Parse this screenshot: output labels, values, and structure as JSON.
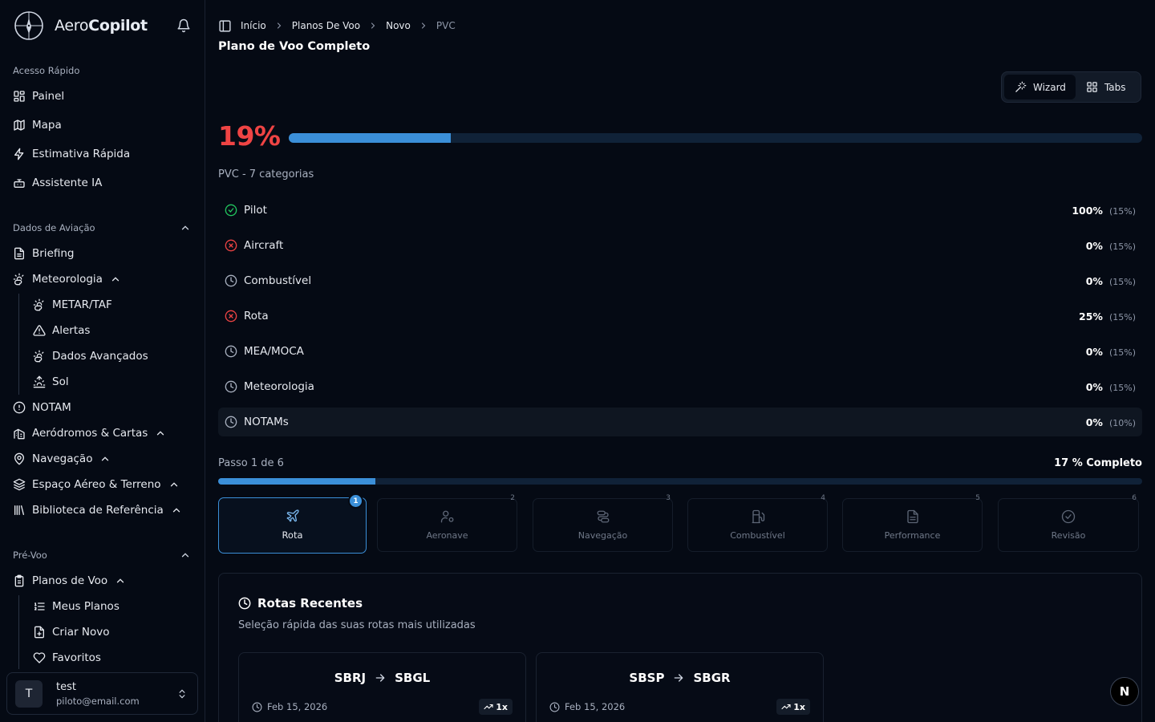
{
  "brand": {
    "name_light": "Aero",
    "name_bold": "Copilot"
  },
  "sidebar": {
    "quick_label": "Acesso Rápido",
    "quick": [
      {
        "label": "Painel",
        "icon": "dashboard-icon"
      },
      {
        "label": "Mapa",
        "icon": "map-icon"
      },
      {
        "label": "Estimativa Rápida",
        "icon": "bolt-icon"
      },
      {
        "label": "Assistente IA",
        "icon": "bot-icon"
      }
    ],
    "aviation_label": "Dados de Aviação",
    "briefing": "Briefing",
    "meteorologia": "Meteorologia",
    "meteo_sub": [
      "METAR/TAF",
      "Alertas",
      "Dados Avançados",
      "Sol"
    ],
    "notam": "NOTAM",
    "aerodromos": "Aeródromos & Cartas",
    "navegacao": "Navegação",
    "espaco": "Espaço Aéreo & Terreno",
    "biblioteca": "Biblioteca de Referência",
    "prevoo_label": "Pré-Voo",
    "planos": "Planos de Voo",
    "planos_sub": [
      "Meus Planos",
      "Criar Novo",
      "Favoritos"
    ]
  },
  "user": {
    "initial": "T",
    "name": "test",
    "email": "piloto@email.com"
  },
  "breadcrumb": [
    "Início",
    "Planos De Voo",
    "Novo",
    "PVC"
  ],
  "page_title": "Plano de Voo Completo",
  "view_toggle": {
    "wizard": "Wizard",
    "tabs": "Tabs",
    "active": "wizard"
  },
  "progress": {
    "percent_label": "19%",
    "fraction": 0.19,
    "subtitle": "PVC - 7 categorias"
  },
  "categories": [
    {
      "name": "Pilot",
      "status": "complete",
      "percent": "100%",
      "weight": "(15%)"
    },
    {
      "name": "Aircraft",
      "status": "error",
      "percent": "0%",
      "weight": "(15%)"
    },
    {
      "name": "Combustível",
      "status": "pending",
      "percent": "0%",
      "weight": "(15%)"
    },
    {
      "name": "Rota",
      "status": "error",
      "percent": "25%",
      "weight": "(15%)"
    },
    {
      "name": "MEA/MOCA",
      "status": "pending",
      "percent": "0%",
      "weight": "(15%)"
    },
    {
      "name": "Meteorologia",
      "status": "pending",
      "percent": "0%",
      "weight": "(15%)"
    },
    {
      "name": "NOTAMs",
      "status": "pending",
      "percent": "0%",
      "weight": "(10%)"
    }
  ],
  "wizard": {
    "step_text": "Passo 1 de 6",
    "complete_text": "17 % Completo",
    "fraction": 0.17,
    "steps": [
      {
        "num": "1",
        "label": "Rota",
        "icon": "plane-icon",
        "active": true
      },
      {
        "num": "2",
        "label": "Aeronave",
        "icon": "user-settings-icon",
        "active": false
      },
      {
        "num": "3",
        "label": "Navegação",
        "icon": "route-icon",
        "active": false
      },
      {
        "num": "4",
        "label": "Combustível",
        "icon": "fuel-icon",
        "active": false
      },
      {
        "num": "5",
        "label": "Performance",
        "icon": "document-icon",
        "active": false
      },
      {
        "num": "6",
        "label": "Revisão",
        "icon": "check-circle-icon",
        "active": false
      }
    ]
  },
  "recent": {
    "title": "Rotas Recentes",
    "description": "Seleção rápida das suas rotas mais utilizadas",
    "routes": [
      {
        "from": "SBRJ",
        "to": "SBGL",
        "date": "Feb 15, 2026",
        "uses": "1x"
      },
      {
        "from": "SBSP",
        "to": "SBGR",
        "date": "Feb 15, 2026",
        "uses": "1x"
      }
    ]
  },
  "colors": {
    "accent": "#3b8fd8",
    "danger": "#ef4444",
    "success": "#22c55e",
    "background": "#050a14"
  },
  "dev_badge": "N"
}
